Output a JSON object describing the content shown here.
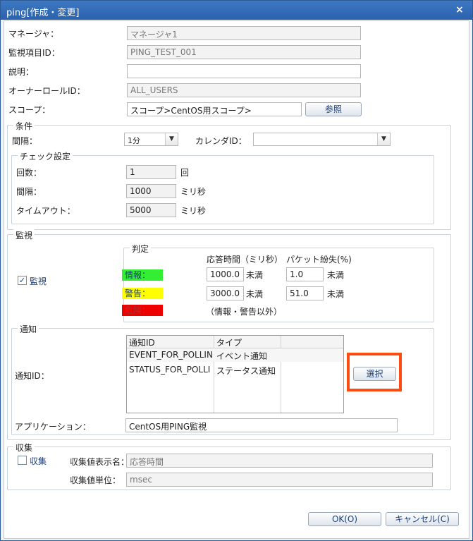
{
  "window": {
    "title": "ping[作成・変更]",
    "close_glyph": "×"
  },
  "general": {
    "manager_label": "マネージャ：",
    "manager_value": "マネージャ1",
    "monitor_id_label": "監視項目ID：",
    "monitor_id_value": "PING_TEST_001",
    "description_label": "説明：",
    "description_value": "",
    "owner_role_label": "オーナーロールID：",
    "owner_role_value": "ALL_USERS",
    "scope_label": "スコープ：",
    "scope_value": "スコープ>CentOS用スコープ>",
    "scope_button": "参照"
  },
  "conditions": {
    "legend": "条件",
    "interval_label": "間隔：",
    "interval_value": "1分",
    "calendar_label": "カレンダID：",
    "calendar_value": "",
    "check": {
      "legend": "チェック設定",
      "count_label": "回数：",
      "count_value": "1",
      "count_unit": "回",
      "interval_label": "間隔：",
      "interval_value": "1000",
      "interval_unit": "ミリ秒",
      "timeout_label": "タイムアウト：",
      "timeout_value": "5000",
      "timeout_unit": "ミリ秒"
    }
  },
  "monitor": {
    "legend": "監視",
    "enabled_label": "監視",
    "enabled": true,
    "judgment": {
      "legend": "判定",
      "col_response": "応答時間（ミリ秒）",
      "col_packet": "パケット紛失(%)",
      "info_label": "情報：",
      "info_response": "1000.0",
      "info_packet": "1.0",
      "warn_label": "警告：",
      "warn_response": "3000.0",
      "warn_packet": "51.0",
      "crit_label": "危険：",
      "crit_note": "（情報・警告以外）",
      "less_than": "未満",
      "colors": {
        "info": "#33ee33",
        "warn": "#ffff00",
        "crit": "#ee0000"
      }
    },
    "notify": {
      "legend": "通知",
      "id_label": "通知ID：",
      "columns": [
        "通知ID",
        "タイプ"
      ],
      "rows": [
        {
          "id": "EVENT_FOR_POLLIN",
          "type": "イベント通知"
        },
        {
          "id": "STATUS_FOR_POLLI",
          "type": "ステータス通知"
        }
      ],
      "select_button": "選択",
      "app_label": "アプリケーション：",
      "app_value": "CentOS用PING監視"
    }
  },
  "collect": {
    "legend": "収集",
    "enabled_label": "収集",
    "enabled": false,
    "display_name_label": "収集値表示名：",
    "display_name_value": "応答時間",
    "unit_label": "収集値単位：",
    "unit_value": "msec"
  },
  "footer": {
    "ok_button": "OK(O)",
    "cancel_button": "キャンセル(C)"
  },
  "highlight_color": "#ff4c12"
}
